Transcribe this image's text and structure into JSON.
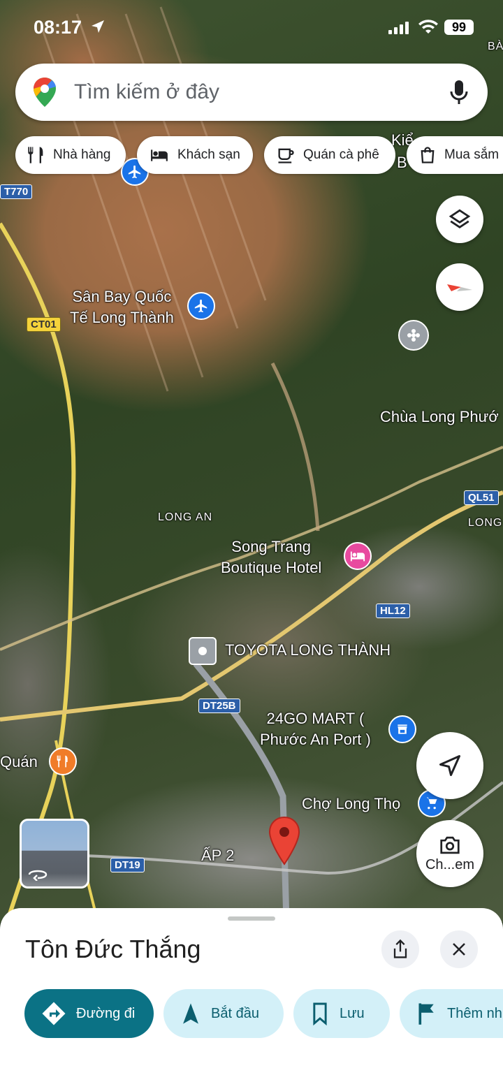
{
  "status_bar": {
    "time": "08:17",
    "battery": "99"
  },
  "search": {
    "placeholder": "Tìm kiếm ở đây"
  },
  "chips": [
    {
      "label": "Nhà hàng",
      "icon": "restaurant-icon"
    },
    {
      "label": "Khách sạn",
      "icon": "hotel-icon"
    },
    {
      "label": "Quán cà phê",
      "icon": "coffee-icon"
    },
    {
      "label": "Mua sắm",
      "icon": "shopping-icon"
    }
  ],
  "map": {
    "labels": {
      "airport": "Sân Bay Quốc\nTế Long Thành",
      "pagoda": "Chùa Long Phướ",
      "long_an": "LONG AN",
      "long_right": "LONG",
      "hotel": "Song Trang\nBoutique Hotel",
      "toyota": "TOYOTA LONG THÀNH",
      "mart": "24GO MART (\nPhước An Port )",
      "quan": "Quán",
      "market": "Chợ Long Thọ",
      "ap2": "ẤP 2",
      "top_right_ba": "BÀ",
      "top_right_b": "B",
      "kieu": "Kiể"
    },
    "shields": {
      "t770": "T770",
      "ct01": "CT01",
      "ql51": "QL51",
      "hl12": "HL12",
      "dt25b": "DT25B",
      "dt19": "DT19"
    },
    "street_view_label": "Ch...em"
  },
  "place": {
    "title": "Tôn Đức Thắng",
    "actions": [
      {
        "label": "Đường đi",
        "icon": "directions-icon"
      },
      {
        "label": "Bắt đầu",
        "icon": "navigation-icon"
      },
      {
        "label": "Lưu",
        "icon": "bookmark-icon"
      },
      {
        "label": "Thêm nh",
        "icon": "flag-icon"
      }
    ]
  }
}
